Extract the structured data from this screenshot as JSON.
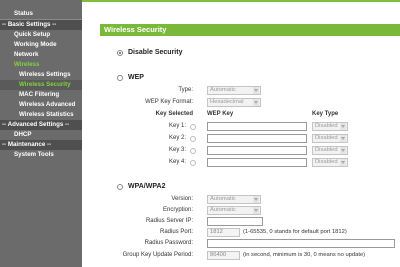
{
  "sidebar": {
    "status": "Status",
    "basic_settings": "-- Basic Settings --",
    "quick_setup": "Quick Setup",
    "working_mode": "Working Mode",
    "network": "Network",
    "wireless": "Wireless",
    "wireless_settings": "Wireless Settings",
    "wireless_security": "Wireless Security",
    "mac_filtering": "MAC Filtering",
    "wireless_advanced": "Wireless Advanced",
    "wireless_statistics": "Wireless Statistics",
    "advanced_settings": "-- Advanced Settings --",
    "dhcp": "DHCP",
    "maintenance": "-- Maintenance --",
    "system_tools": "System Tools"
  },
  "page": {
    "title": "Wireless Security"
  },
  "disable": {
    "label": "Disable Security",
    "selected": true
  },
  "wep": {
    "label": "WEP",
    "type_label": "Type:",
    "type_value": "Automatic",
    "format_label": "WEP Key Format:",
    "format_value": "Hexadecimal",
    "key_selected_header": "Key Selected",
    "wep_key_header": "WEP Key",
    "key_type_header": "Key Type",
    "keys": [
      {
        "label": "Key 1:",
        "value": "",
        "type": "Disabled"
      },
      {
        "label": "Key 2:",
        "value": "",
        "type": "Disabled"
      },
      {
        "label": "Key 3:",
        "value": "",
        "type": "Disabled"
      },
      {
        "label": "Key 4:",
        "value": "",
        "type": "Disabled"
      }
    ]
  },
  "wpa": {
    "label": "WPA/WPA2",
    "version_label": "Version:",
    "version_value": "Automatic",
    "encryption_label": "Encryption:",
    "encryption_value": "Automatic",
    "radius_ip_label": "Radius Server IP:",
    "radius_ip_value": "",
    "radius_port_label": "Radius Port:",
    "radius_port_value": "1812",
    "radius_port_hint": "(1-65535, 0 stands for default port 1812)",
    "radius_password_label": "Radius Password:",
    "radius_password_value": "",
    "group_key_label": "Group Key Update Period:",
    "group_key_value": "86400",
    "group_key_hint": "(in second, minimum is 30, 0 means no update)"
  },
  "colors": {
    "accent": "#7ab83a",
    "active_nav": "#7fd43d",
    "sidebar": "#6b6b6b"
  }
}
